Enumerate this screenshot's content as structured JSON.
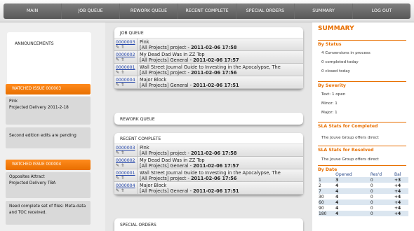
{
  "nav": [
    "MAIN",
    "JOB QUEUE",
    "REWORK QUEUE",
    "RECENT COMPLETE",
    "SPECIAL ORDERS",
    "SUMMARY",
    "LOG OUT"
  ],
  "announcements": "ANNOUNCEMENTS",
  "watched": [
    {
      "bar": "WATCHED ISSUE 000003",
      "title": "Pink",
      "delivery": "Projected Delivery 2011-2-18",
      "note": "Second edition edits are pending"
    },
    {
      "bar": "WATCHED ISSUE 000004",
      "title": "Opposites Attract",
      "delivery": "Projected Delivery TBA",
      "note": "Need complete set of files: Meta-data and TOC received."
    }
  ],
  "job_queue": {
    "title": "JOB QUEUE",
    "rows": [
      {
        "id": "0000003",
        "l1": "Pink",
        "l2a": "[All Projects] project - ",
        "l2b": "2011-02-06 17:58"
      },
      {
        "id": "0000002",
        "l1": "My Dead Dad Was in ZZ Top",
        "l2a": "[All Projects] General - ",
        "l2b": "2011-02-06 17:57"
      },
      {
        "id": "0000001",
        "l1": "Wall Street Journal Guide to Investing in the Apocalypse, The",
        "l2a": "[All Projects] project - ",
        "l2b": "2011-02-06 17:56"
      },
      {
        "id": "0000004",
        "l1": "Major Block",
        "l2a": "[All Projects] General - ",
        "l2b": "2011-02-06 17:51"
      }
    ]
  },
  "rework": {
    "title": "REWORK QUEUE"
  },
  "recent": {
    "title": "RECENT COMPLETE",
    "rows": [
      {
        "id": "0000003",
        "l1": "Pink",
        "l2a": "[All Projects] project - ",
        "l2b": "2011-02-06 17:58"
      },
      {
        "id": "0000002",
        "l1": "My Dead Dad Was in ZZ Top",
        "l2a": "[All Projects] General - ",
        "l2b": "2011-02-06 17:57"
      },
      {
        "id": "0000001",
        "l1": "Wall Street Journal Guide to Investing in the Apocalypse, The",
        "l2a": "[All Projects] project - ",
        "l2b": "2011-02-06 17:56"
      },
      {
        "id": "0000004",
        "l1": "Major Block",
        "l2a": "[All Projects] General - ",
        "l2b": "2011-02-06 17:51"
      }
    ]
  },
  "special": {
    "title": "SPECIAL ORDERS"
  },
  "summary": {
    "title": "SUMMARY",
    "by_status": "By Status",
    "status": [
      "4 Conversions in process",
      "0 completed today",
      "0 closed today"
    ],
    "by_severity": "By Severity",
    "severity": [
      "Text: 1 open",
      "Minor: 1",
      "Major: 1"
    ],
    "sla_completed": "SLA Stats for Completed",
    "sla_completed_text": "The Jouve Group offers direct",
    "sla_resolved": "SLA Stats for Resolved",
    "sla_resolved_text": "The Jouve Group offers direct",
    "by_date": "By Date",
    "table_head": [
      "",
      "Opened",
      "Res'd",
      "Bal"
    ],
    "table": [
      [
        "1",
        "3",
        "0",
        "+3"
      ],
      [
        "2",
        "4",
        "0",
        "+4"
      ],
      [
        "7",
        "4",
        "0",
        "+4"
      ],
      [
        "30",
        "4",
        "0",
        "+4"
      ],
      [
        "60",
        "4",
        "0",
        "+4"
      ],
      [
        "90",
        "4",
        "0",
        "+4"
      ],
      [
        "180",
        "4",
        "0",
        "+4"
      ]
    ]
  },
  "icons": {
    "edit": "pencil-icon",
    "move": "arrows-icon"
  }
}
